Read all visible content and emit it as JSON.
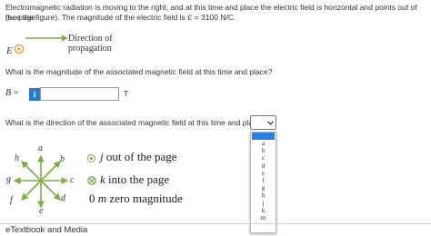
{
  "question": {
    "intro_line1": "Electromagnetic radiation is moving to the right, and at this time and place the electric field is horizontal and points out of the page",
    "intro_line2_prefix": "(see the figure). The magnitude of the electric field is ",
    "intro_var": "E",
    "intro_eq": " = ",
    "intro_value": "3100 N/C."
  },
  "figure1": {
    "e_label": "E",
    "prop_line1": "Direction of",
    "prop_line2": "propagation",
    "colors": {
      "arrow": "#7ab043",
      "marker": "#e8a33d"
    }
  },
  "part1": {
    "question": "What is the magnitude of the associated magnetic field at this time and place?",
    "var_label": "B",
    "eq": "=",
    "info_icon": "i",
    "input_value": "",
    "unit": "T"
  },
  "part2": {
    "question": "What is the direction of the associated magnetic field at this time and place?",
    "select_icon": "chevron-down-icon",
    "options": [
      "a",
      "b",
      "c",
      "d",
      "e",
      "f",
      "g",
      "h",
      "j",
      "k",
      "m"
    ]
  },
  "compass": {
    "labels": {
      "a": "a",
      "b": "b",
      "c": "c",
      "d": "d",
      "e": "e",
      "f": "f",
      "g": "g",
      "h": "h"
    },
    "arrow_color": "#7ab043"
  },
  "legend": {
    "j_letter": "j",
    "j_text": " out of the page",
    "k_letter": "k",
    "k_text": " into the page",
    "m_prefix": "0 ",
    "m_letter": "m",
    "m_text": " zero magnitude"
  },
  "footer": {
    "etextbook": "eTextbook and Media"
  }
}
